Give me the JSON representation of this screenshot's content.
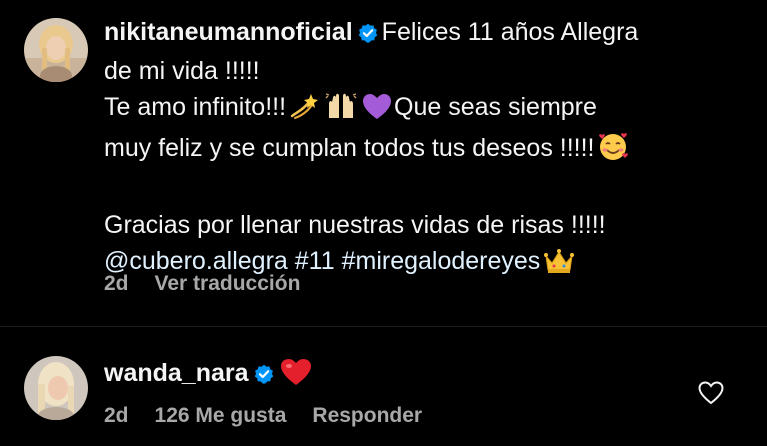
{
  "post": {
    "username": "nikitaneumannoficial",
    "caption_line1": "Felices 11 años Allegra",
    "caption_line2": "de mi vida !!!!!",
    "caption_line3": "Te amo infinito!!!",
    "caption_line3b": "Que seas siempre",
    "caption_line4": "muy feliz y se cumplan todos tus deseos !!!!!",
    "caption_line6": "Gracias por llenar nuestras vidas de risas !!!!!",
    "mention": "@cubero.allegra",
    "hashtag1": "#11",
    "hashtag2": "#miregalodereyes",
    "time": "2d",
    "translate_label": "Ver traducción"
  },
  "reply": {
    "username": "wanda_nara",
    "time": "2d",
    "likes_label": "126 Me gusta",
    "reply_label": "Responder"
  },
  "icons": {
    "verified": "verified-badge-icon",
    "dizzy": "dizzy-emoji",
    "raised_hands": "raised-hands-emoji",
    "purple_heart": "purple-heart-emoji",
    "smiling_hearts": "smiling-face-with-hearts-emoji",
    "crown": "crown-emoji",
    "red_heart": "red-heart-emoji",
    "like": "heart-outline-icon"
  },
  "colors": {
    "background": "#000000",
    "text": "#f5f5f5",
    "secondary": "#a8a8a8",
    "verified": "#0095f6",
    "mention": "#e0f1ff"
  }
}
